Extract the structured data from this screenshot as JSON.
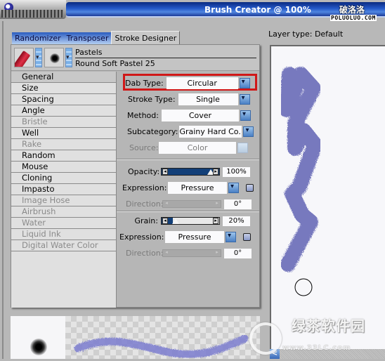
{
  "window": {
    "title": "Brush Creator @ 100%",
    "watermark_top": "破洛洛",
    "watermark_top_url": "POLUOLUO.COM",
    "watermark_bottom": "绿茶软件园",
    "watermark_bottom_url": "www.33LC.com"
  },
  "tabs": [
    {
      "label": "Randomizer",
      "active": false
    },
    {
      "label": "Transposer",
      "active": false
    },
    {
      "label": "Stroke Designer",
      "active": true
    }
  ],
  "brush": {
    "category": "Pastels",
    "variant": "Round Soft Pastel 25"
  },
  "categories": [
    {
      "label": "General",
      "enabled": true,
      "selected": true
    },
    {
      "label": "Size",
      "enabled": true
    },
    {
      "label": "Spacing",
      "enabled": true
    },
    {
      "label": "Angle",
      "enabled": true
    },
    {
      "label": "Bristle",
      "enabled": false
    },
    {
      "label": "Well",
      "enabled": true
    },
    {
      "label": "Rake",
      "enabled": false
    },
    {
      "label": "Random",
      "enabled": true
    },
    {
      "label": "Mouse",
      "enabled": true
    },
    {
      "label": "Cloning",
      "enabled": true
    },
    {
      "label": "Impasto",
      "enabled": true
    },
    {
      "label": "Image Hose",
      "enabled": false
    },
    {
      "label": "Airbrush",
      "enabled": false
    },
    {
      "label": "Water",
      "enabled": false
    },
    {
      "label": "Liquid Ink",
      "enabled": false
    },
    {
      "label": "Digital Water Color",
      "enabled": false
    }
  ],
  "general": {
    "dab_type": {
      "label": "Dab Type:",
      "value": "Circular"
    },
    "stroke_type": {
      "label": "Stroke Type:",
      "value": "Single"
    },
    "method": {
      "label": "Method:",
      "value": "Cover"
    },
    "subcategory": {
      "label": "Subcategory:",
      "value": "Grainy Hard Co..."
    },
    "source": {
      "label": "Source:",
      "value": "Color"
    },
    "opacity": {
      "label": "Opacity:",
      "value": "100%",
      "percent": 100,
      "expression_label": "Expression:",
      "expression": "Pressure",
      "direction_label": "Direction:",
      "direction": "0°"
    },
    "grain": {
      "label": "Grain:",
      "value": "20%",
      "percent": 20,
      "expression_label": "Expression:",
      "expression": "Pressure",
      "direction_label": "Direction:",
      "direction": "0°"
    }
  },
  "preview": {
    "layer_type": "Layer type: Default",
    "stroke_color": "#6a6cb8",
    "scroll_left": "<"
  },
  "colors": {
    "highlight": "#d01818",
    "title_bar": "#2458c8",
    "stroke": "#6a6cb8"
  }
}
